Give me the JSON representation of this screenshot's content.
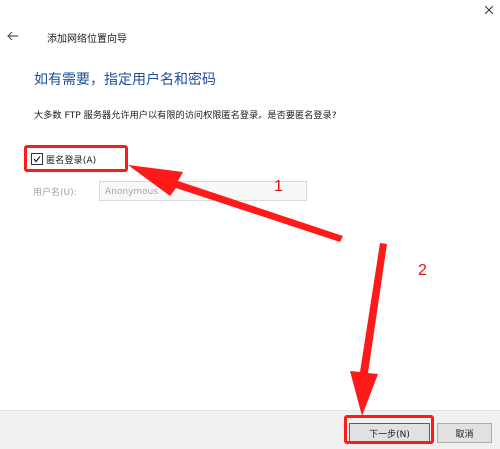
{
  "window": {
    "title": "添加网络位置向导",
    "icons": {
      "back": "back-arrow-icon",
      "close": "close-icon"
    }
  },
  "main": {
    "heading": "如有需要，指定用户名和密码",
    "description": "大多数 FTP 服务器允许用户以有限的访问权限匿名登录。是否要匿名登录?",
    "anonymous_checkbox": {
      "label": "匿名登录(A)",
      "checked": true
    },
    "username": {
      "label": "用户名(U):",
      "value": "Anonymous"
    }
  },
  "footer": {
    "next_label": "下一步(N)",
    "cancel_label": "取消"
  },
  "annotations": {
    "step1": "1",
    "step2": "2",
    "color": "#ff1a1a"
  }
}
